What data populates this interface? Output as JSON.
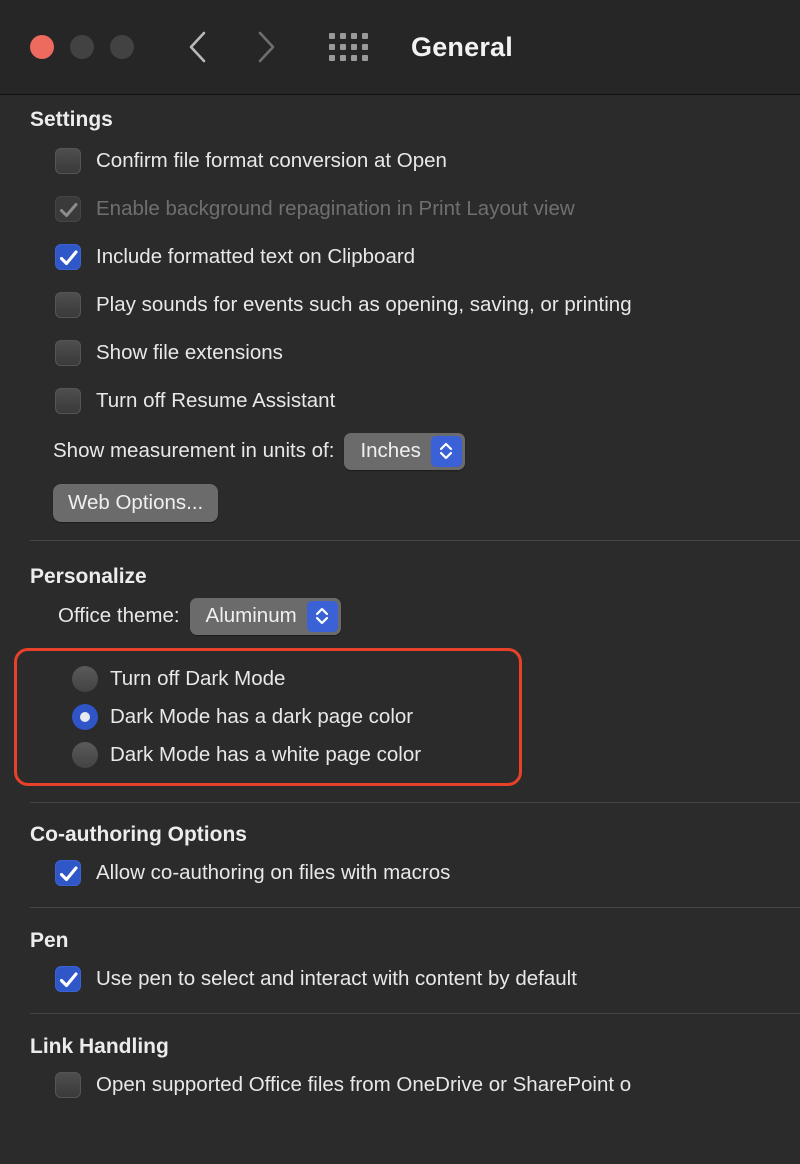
{
  "window": {
    "title": "General",
    "traffic_lights": [
      "close",
      "minimize",
      "maximize"
    ],
    "back_label": "Back",
    "forward_label": "Forward",
    "show_all_label": "Show All"
  },
  "accent_colors": {
    "checkbox_on": "#3057c8",
    "radio_on": "#2f55c8",
    "popup_arrow": "#3a61d6",
    "annotation_border": "#e8412a",
    "close_button": "#ec6a5e",
    "window_background": "#2b2b2b",
    "titlebar_background": "#262626"
  },
  "sections": {
    "settings": {
      "title": "Settings",
      "checkboxes": [
        {
          "label": "Confirm file format conversion at Open",
          "state": "off",
          "disabled": false
        },
        {
          "label": "Enable background repagination in Print Layout view",
          "state": "on",
          "disabled": true
        },
        {
          "label": "Include formatted text on Clipboard",
          "state": "on",
          "disabled": false
        },
        {
          "label": "Play sounds for events such as opening, saving, or printing",
          "state": "off",
          "disabled": false
        },
        {
          "label": "Show file extensions",
          "state": "off",
          "disabled": false
        },
        {
          "label": "Turn off Resume Assistant",
          "state": "off",
          "disabled": false
        }
      ],
      "measurement": {
        "label": "Show measurement in units of:",
        "value": "Inches"
      },
      "web_options_label": "Web Options..."
    },
    "personalize": {
      "title": "Personalize",
      "office_theme": {
        "label": "Office theme:",
        "value": "Aluminum"
      },
      "dark_mode_options": [
        {
          "label": "Turn off Dark Mode",
          "selected": false
        },
        {
          "label": "Dark Mode has a dark page color",
          "selected": true
        },
        {
          "label": "Dark Mode has a white page color",
          "selected": false
        }
      ]
    },
    "coauthoring": {
      "title": "Co-authoring Options",
      "checkboxes": [
        {
          "label": "Allow co-authoring on files with macros",
          "state": "on",
          "disabled": false
        }
      ]
    },
    "pen": {
      "title": "Pen",
      "checkboxes": [
        {
          "label": "Use pen to select and interact with content by default",
          "state": "on",
          "disabled": false
        }
      ]
    },
    "link_handling": {
      "title": "Link Handling",
      "checkboxes": [
        {
          "label": "Open supported Office files from OneDrive or SharePoint o",
          "state": "off",
          "disabled": false
        }
      ]
    }
  }
}
